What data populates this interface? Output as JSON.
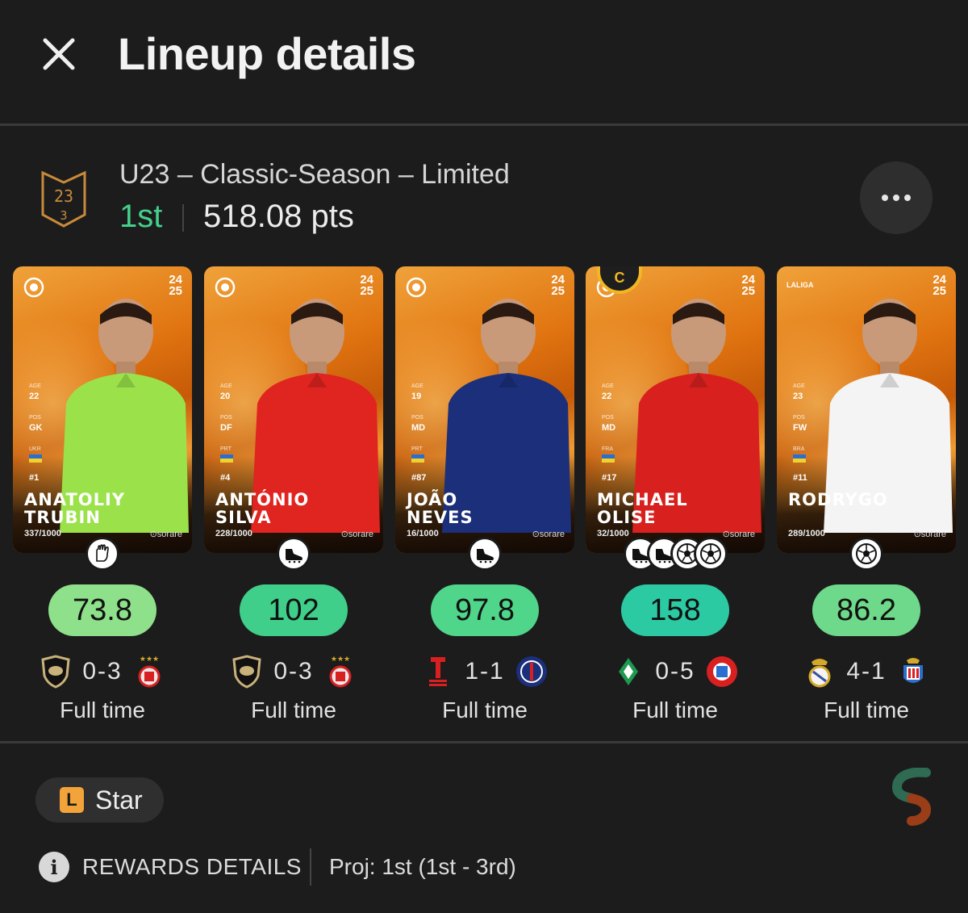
{
  "header": {
    "title": "Lineup details",
    "close_icon": "close-icon"
  },
  "competition": {
    "badge_top": "23",
    "badge_bottom": "3",
    "name": "U23 – Classic-Season – Limited",
    "rank": "1st",
    "points": "518.08 pts",
    "more_icon": "more-horizontal-icon"
  },
  "players": [
    {
      "first": "ANATOLIY",
      "last": "TRUBIN",
      "serial": "337/1000",
      "season_top": "24",
      "season_bottom": "25",
      "age": "22",
      "pos": "GK",
      "nat": "UKR",
      "num": "#1",
      "stats_labels": {
        "age": "AGE",
        "pos": "POS"
      },
      "brand": "⊙sorare",
      "score": "73.8",
      "score_color": "#8ee08a",
      "home_result": "0-3",
      "status": "Full time",
      "position_icons": [
        "goalkeeper-gloves-icon"
      ],
      "kit": "#9be24a",
      "home_club": "club-shield-icon",
      "away_club": "benfica-crest-icon"
    },
    {
      "first": "ANTÓNIO",
      "last": "SILVA",
      "serial": "228/1000",
      "season_top": "24",
      "season_bottom": "25",
      "age": "20",
      "pos": "DF",
      "nat": "PRT",
      "num": "#4",
      "stats_labels": {
        "age": "AGE",
        "pos": "POS"
      },
      "brand": "⊙sorare",
      "score": "102",
      "score_color": "#3fcf8a",
      "home_result": "0-3",
      "status": "Full time",
      "position_icons": [
        "boot-icon"
      ],
      "kit": "#e0241f",
      "home_club": "club-shield-icon",
      "away_club": "benfica-crest-icon"
    },
    {
      "first": "JOÃO",
      "last": "NEVES",
      "serial": "16/1000",
      "season_top": "24",
      "season_bottom": "25",
      "age": "19",
      "pos": "MD",
      "nat": "PRT",
      "num": "#87",
      "stats_labels": {
        "age": "AGE",
        "pos": "POS"
      },
      "brand": "⊙sorare",
      "score": "97.8",
      "score_color": "#4fd68a",
      "home_result": "1-1",
      "status": "Full time",
      "position_icons": [
        "boot-icon"
      ],
      "kit": "#1b2f7a",
      "home_club": "reims-crest-icon",
      "away_club": "psg-crest-icon"
    },
    {
      "first": "MICHAEL",
      "last": "OLISE",
      "serial": "32/1000",
      "season_top": "24",
      "season_bottom": "25",
      "age": "22",
      "pos": "MD",
      "nat": "FRA",
      "num": "#17",
      "stats_labels": {
        "age": "AGE",
        "pos": "POS"
      },
      "brand": "⊙sorare",
      "score": "158",
      "score_color": "#2ccaa3",
      "home_result": "0-5",
      "status": "Full time",
      "position_icons": [
        "boot-icon",
        "boot-icon",
        "ball-icon",
        "ball-icon"
      ],
      "captain": "C",
      "kit": "#d8211f",
      "home_club": "werder-crest-icon",
      "away_club": "bayern-crest-icon"
    },
    {
      "first": "",
      "last": "RODRYGO",
      "serial": "289/1000",
      "season_top": "24",
      "season_bottom": "25",
      "age": "23",
      "pos": "FW",
      "nat": "BRA",
      "num": "#11",
      "stats_labels": {
        "age": "AGE",
        "pos": "POS"
      },
      "brand": "⊙sorare",
      "league_tag": "LALIGA",
      "score": "86.2",
      "score_color": "#6ed98a",
      "home_result": "4-1",
      "status": "Full time",
      "position_icons": [
        "ball-icon"
      ],
      "kit": "#f4f4f4",
      "home_club": "real-madrid-crest-icon",
      "away_club": "espanyol-crest-icon"
    }
  ],
  "footer": {
    "league_badge": "L",
    "league_label": "Star",
    "rewards_label": "REWARDS DETAILS",
    "info_icon": "info-icon",
    "projection": "Proj: 1st (1st - 3rd)",
    "logo": "sorare-logo-icon"
  },
  "colors": {
    "accent_green": "#43d08a",
    "background": "#1c1c1c",
    "league_orange": "#f2a43a",
    "captain_gold": "#f2b623"
  }
}
